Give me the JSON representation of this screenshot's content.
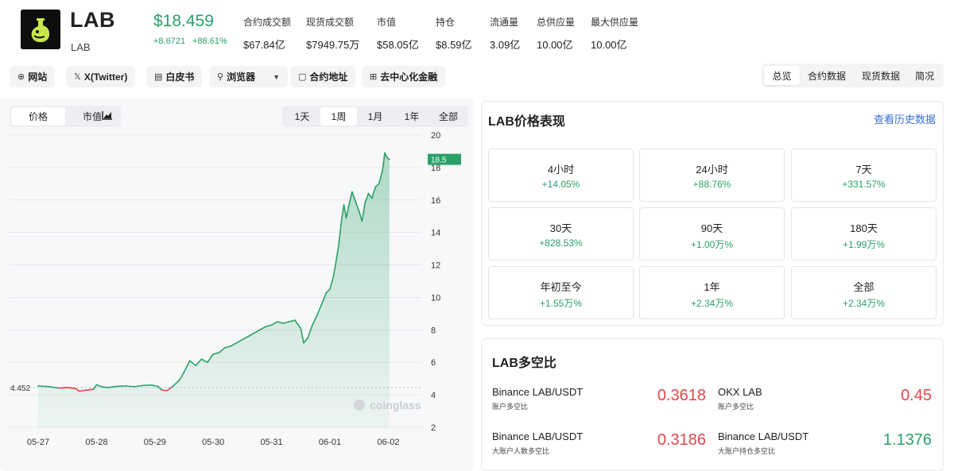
{
  "header": {
    "name": "LAB",
    "symbol": "LAB",
    "price": "$18.459",
    "change_abs": "+8.6721",
    "change_pct": "+88.61%",
    "stats": [
      {
        "label": "合约成交额",
        "value": "$67.84亿"
      },
      {
        "label": "现货成交额",
        "value": "$7949.75万"
      },
      {
        "label": "市值",
        "value": "$58.05亿"
      },
      {
        "label": "持仓",
        "value": "$8.59亿"
      },
      {
        "label": "流通量",
        "value": "3.09亿"
      },
      {
        "label": "总供应量",
        "value": "10.00亿"
      },
      {
        "label": "最大供应量",
        "value": "10.00亿"
      }
    ]
  },
  "links": {
    "website": "网站",
    "twitter": "X(Twitter)",
    "whitepaper": "白皮书",
    "explorer": "浏览器",
    "contract": "合约地址",
    "defi": "去中心化金融"
  },
  "tabs": [
    "总览",
    "合约数据",
    "现货数据",
    "简况"
  ],
  "chart_controls": {
    "mode": [
      "价格",
      "市值"
    ],
    "ranges": [
      "1天",
      "1周",
      "1月",
      "1年",
      "全部"
    ],
    "active_range": "1周"
  },
  "chart_data": {
    "type": "area",
    "x_ticks": [
      "05-27",
      "05-28",
      "05-29",
      "05-30",
      "05-31",
      "06-01",
      "06-02"
    ],
    "y_ticks": [
      "20",
      "18",
      "16",
      "14",
      "12",
      "10",
      "8",
      "6",
      "4",
      "2"
    ],
    "ylim": [
      2,
      20
    ],
    "baseline": 4.452,
    "baseline_label": "4.452",
    "last_label": "18.5",
    "watermark": "coinglass",
    "points": [
      [
        0,
        4.55
      ],
      [
        0.1,
        4.52
      ],
      [
        0.2,
        4.5
      ],
      [
        0.35,
        4.42
      ],
      [
        0.5,
        4.45
      ],
      [
        0.65,
        4.38
      ],
      [
        0.7,
        4.22
      ],
      [
        0.85,
        4.3
      ],
      [
        0.95,
        4.35
      ],
      [
        1.0,
        4.62
      ],
      [
        1.1,
        4.48
      ],
      [
        1.2,
        4.45
      ],
      [
        1.35,
        4.52
      ],
      [
        1.5,
        4.55
      ],
      [
        1.65,
        4.5
      ],
      [
        1.8,
        4.58
      ],
      [
        1.95,
        4.6
      ],
      [
        2.05,
        4.52
      ],
      [
        2.12,
        4.3
      ],
      [
        2.2,
        4.25
      ],
      [
        2.3,
        4.5
      ],
      [
        2.42,
        4.9
      ],
      [
        2.5,
        5.4
      ],
      [
        2.6,
        6.1
      ],
      [
        2.7,
        5.8
      ],
      [
        2.8,
        6.2
      ],
      [
        2.9,
        6.0
      ],
      [
        3.0,
        6.5
      ],
      [
        3.1,
        6.6
      ],
      [
        3.2,
        6.9
      ],
      [
        3.3,
        7.0
      ],
      [
        3.4,
        7.2
      ],
      [
        3.5,
        7.4
      ],
      [
        3.6,
        7.6
      ],
      [
        3.7,
        7.8
      ],
      [
        3.8,
        8.0
      ],
      [
        3.9,
        8.2
      ],
      [
        4.0,
        8.3
      ],
      [
        4.1,
        8.5
      ],
      [
        4.2,
        8.4
      ],
      [
        4.3,
        8.5
      ],
      [
        4.4,
        8.6
      ],
      [
        4.5,
        8.1
      ],
      [
        4.55,
        7.2
      ],
      [
        4.62,
        7.5
      ],
      [
        4.7,
        8.3
      ],
      [
        4.78,
        8.9
      ],
      [
        4.86,
        9.6
      ],
      [
        4.94,
        10.3
      ],
      [
        5.0,
        10.5
      ],
      [
        5.06,
        11.3
      ],
      [
        5.1,
        12.1
      ],
      [
        5.15,
        13.2
      ],
      [
        5.2,
        14.8
      ],
      [
        5.24,
        15.7
      ],
      [
        5.28,
        14.9
      ],
      [
        5.32,
        15.6
      ],
      [
        5.38,
        16.5
      ],
      [
        5.44,
        15.9
      ],
      [
        5.5,
        15.3
      ],
      [
        5.55,
        14.7
      ],
      [
        5.6,
        15.8
      ],
      [
        5.66,
        16.4
      ],
      [
        5.72,
        16.1
      ],
      [
        5.78,
        16.8
      ],
      [
        5.84,
        17.0
      ],
      [
        5.9,
        17.8
      ],
      [
        5.94,
        18.9
      ],
      [
        5.98,
        18.6
      ],
      [
        6.02,
        18.5
      ]
    ]
  },
  "performance": {
    "title": "LAB价格表现",
    "history_link": "查看历史数据",
    "items": [
      {
        "label": "4小时",
        "value": "+14.05%"
      },
      {
        "label": "24小时",
        "value": "+88.76%"
      },
      {
        "label": "7天",
        "value": "+331.57%"
      },
      {
        "label": "30天",
        "value": "+828.53%"
      },
      {
        "label": "90天",
        "value": "+1.00万%"
      },
      {
        "label": "180天",
        "value": "+1.99万%"
      },
      {
        "label": "年初至今",
        "value": "+1.55万%"
      },
      {
        "label": "1年",
        "value": "+2.34万%"
      },
      {
        "label": "全部",
        "value": "+2.34万%"
      }
    ]
  },
  "long_short": {
    "title": "LAB多空比",
    "items": [
      {
        "name": "Binance LAB/USDT",
        "sub": "账户多空比",
        "value": "0.3618",
        "color": "#e0474c"
      },
      {
        "name": "OKX LAB",
        "sub": "账户多空比",
        "value": "0.45",
        "color": "#e0474c"
      },
      {
        "name": "Binance LAB/USDT",
        "sub": "大账户人数多空比",
        "value": "0.3186",
        "color": "#e0474c"
      },
      {
        "name": "Binance LAB/USDT",
        "sub": "大账户持仓多空比",
        "value": "1.1376",
        "color": "#2aa168"
      }
    ]
  }
}
